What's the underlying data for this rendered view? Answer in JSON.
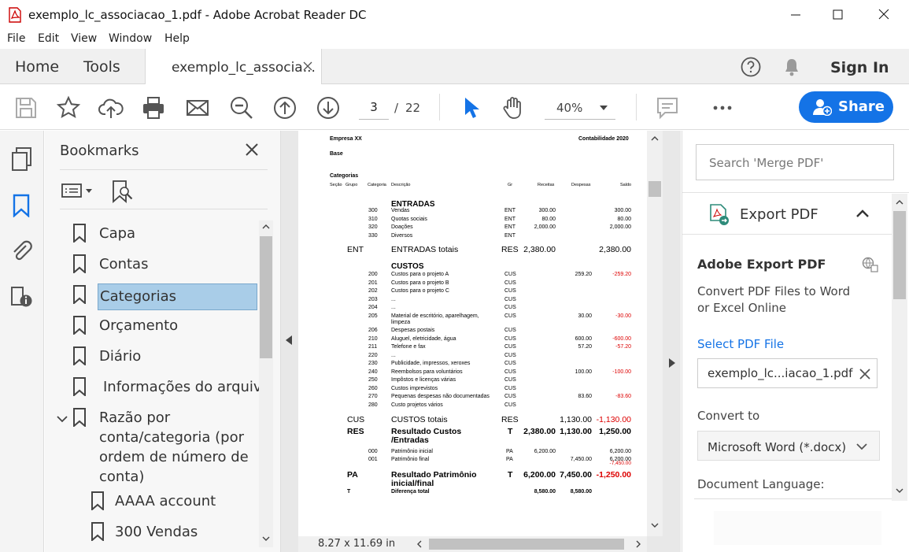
{
  "window": {
    "title": "exemplo_lc_associacao_1.pdf - Adobe Acrobat Reader DC"
  },
  "menu": [
    "File",
    "Edit",
    "View",
    "Window",
    "Help"
  ],
  "tabs": {
    "home": "Home",
    "tools": "Tools",
    "document": "exemplo_lc_associa..."
  },
  "header": {
    "sign_in": "Sign In"
  },
  "toolbar": {
    "page_current": "3",
    "page_sep": "/",
    "page_total": "22",
    "zoom": "40%",
    "share": "Share"
  },
  "bookmarks": {
    "title": "Bookmarks",
    "items": [
      "Capa",
      "Contas",
      "Categorias",
      "Orçamento",
      "Diário",
      "Informações do arquivo",
      "Razão por",
      "conta/categoria (por",
      "ordem de número de",
      "conta)",
      "AAAA account",
      "300 Vendas"
    ],
    "selected": "Categorias"
  },
  "page": {
    "company": "Empresa XX",
    "doc_title": "Contabilidade 2020",
    "base": "Base",
    "section": "Categorias",
    "headers": {
      "secao": "Seção",
      "grupo": "Grupo",
      "categoria": "Categoria",
      "descricao": "Descrição",
      "gr": "Gr",
      "receitas": "Receitas",
      "despesas": "Despesas",
      "saldo": "Saldo"
    },
    "entradas_title": "ENTRADAS",
    "entradas_rows": [
      {
        "cat": "300",
        "desc": "Vendas",
        "gr": "ENT",
        "rec": "300.00",
        "desp": "",
        "saldo": "300.00"
      },
      {
        "cat": "310",
        "desc": "Quotas sociais",
        "gr": "ENT",
        "rec": "80.00",
        "desp": "",
        "saldo": "80.00"
      },
      {
        "cat": "320",
        "desc": "Doações",
        "gr": "ENT",
        "rec": "2,000.00",
        "desp": "",
        "saldo": "2,000.00"
      },
      {
        "cat": "330",
        "desc": "Diversos",
        "gr": "ENT",
        "rec": "",
        "desp": "",
        "saldo": ""
      }
    ],
    "entradas_total": {
      "code": "ENT",
      "label": "ENTRADAS totais",
      "gr": "RES",
      "rec": "2,380.00",
      "saldo": "2,380.00"
    },
    "custos_title": "CUSTOS",
    "custos_rows": [
      {
        "cat": "200",
        "desc": "Custos para o projeto A",
        "gr": "CUS",
        "desp": "259.20",
        "saldo": "-259.20"
      },
      {
        "cat": "201",
        "desc": "Custos para o projeto B",
        "gr": "CUS",
        "desp": "",
        "saldo": ""
      },
      {
        "cat": "202",
        "desc": "Custos para o projeto C",
        "gr": "CUS",
        "desp": "",
        "saldo": ""
      },
      {
        "cat": "203",
        "desc": "...",
        "gr": "CUS",
        "desp": "",
        "saldo": ""
      },
      {
        "cat": "204",
        "desc": "...",
        "gr": "CUS",
        "desp": "",
        "saldo": ""
      },
      {
        "cat": "205",
        "desc": "Material de escritório, aparelhagem,",
        "desc2": "limpeza",
        "gr": "CUS",
        "desp": "30.00",
        "saldo": "-30.00"
      },
      {
        "cat": "206",
        "desc": "Despesas postais",
        "gr": "CUS",
        "desp": "",
        "saldo": ""
      },
      {
        "cat": "210",
        "desc": "Aluguel, eletricidade, água",
        "gr": "CUS",
        "desp": "600.00",
        "saldo": "-600.00"
      },
      {
        "cat": "211",
        "desc": "Telefone e fax",
        "gr": "CUS",
        "desp": "57.20",
        "saldo": "-57.20"
      },
      {
        "cat": "220",
        "desc": "...",
        "gr": "CUS",
        "desp": "",
        "saldo": ""
      },
      {
        "cat": "230",
        "desc": "Publicidade, impressos, xeroxes",
        "gr": "CUS",
        "desp": "",
        "saldo": ""
      },
      {
        "cat": "240",
        "desc": "Reembolsos para voluntários",
        "gr": "CUS",
        "desp": "100.00",
        "saldo": "-100.00"
      },
      {
        "cat": "250",
        "desc": "Impôstos e licenças várias",
        "gr": "CUS",
        "desp": "",
        "saldo": ""
      },
      {
        "cat": "260",
        "desc": "Custos imprevistos",
        "gr": "CUS",
        "desp": "",
        "saldo": ""
      },
      {
        "cat": "270",
        "desc": "Pequenas despesas não documentadas",
        "gr": "CUS",
        "desp": "83.60",
        "saldo": "-83.60"
      },
      {
        "cat": "280",
        "desc": "Custo projetos vários",
        "gr": "CUS",
        "desp": "",
        "saldo": ""
      }
    ],
    "custos_total": {
      "code": "CUS",
      "label": "CUSTOS totais",
      "gr": "RES",
      "desp": "1,130.00",
      "saldo": "-1,130.00"
    },
    "res_row": {
      "code": "RES",
      "label": "Resultado Custos",
      "label2": "/Entradas",
      "gr": "T",
      "rec": "2,380.00",
      "desp": "1,130.00",
      "saldo": "1,250.00"
    },
    "pat_rows": [
      {
        "cat": "000",
        "desc": "Patrimônio inicial",
        "gr": "PA",
        "rec": "6,200.00",
        "desp": "",
        "saldo": "6,200.00"
      },
      {
        "cat": "001",
        "desc": "Patrimônio final",
        "gr": "PA",
        "rec": "",
        "desp": "7,450.00",
        "saldo": "6,200.00",
        "saldo2": "-7,450.00"
      }
    ],
    "pa_row": {
      "code": "PA",
      "label": "Resultado Patrimônio",
      "label2": "inicial/final",
      "gr": "T",
      "rec": "6,200.00",
      "desp": "7,450.00",
      "saldo": "-1,250.00"
    },
    "t_row": {
      "code": "T",
      "label": "Diferença total",
      "rec": "8,580.00",
      "desp": "8,580.00"
    }
  },
  "status": {
    "page_size": "8.27 x 11.69 in"
  },
  "right_panel": {
    "search_placeholder": "Search 'Merge PDF'",
    "export_title": "Export PDF",
    "adobe_export": "Adobe Export PDF",
    "desc1": "Convert PDF Files to Word",
    "desc2": "or Excel Online",
    "select_file": "Select PDF File",
    "file_name": "exemplo_lc...iacao_1.pdf",
    "convert_to": "Convert to",
    "format": "Microsoft Word (*.docx)",
    "doc_language": "Document Language:"
  },
  "colors": {
    "accent": "#1473e6",
    "selected_bookmark": "#a9cde8",
    "negative": "#dd0000"
  }
}
